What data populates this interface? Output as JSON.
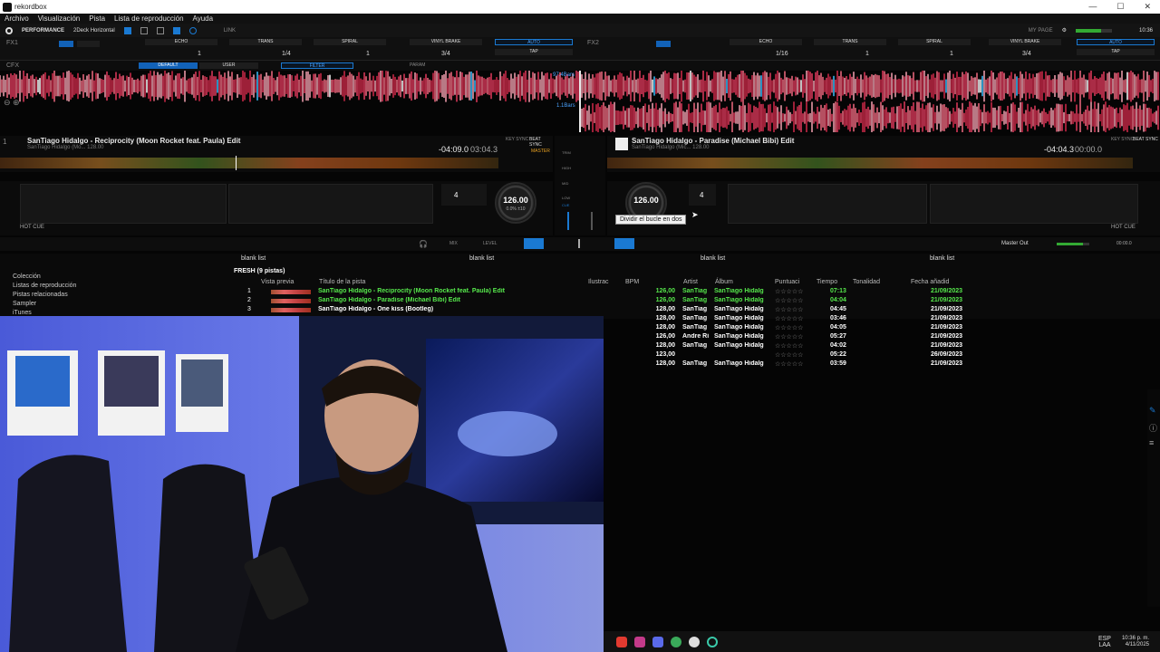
{
  "window": {
    "title": "rekordbox",
    "min": "—",
    "max": "☐",
    "close": "✕"
  },
  "menu": [
    "Archivo",
    "Visualización",
    "Pista",
    "Lista de reproducción",
    "Ayuda"
  ],
  "toolbar": {
    "mode": "PERFORMANCE",
    "layout": "2Deck Horizontal",
    "link": "LINK",
    "mypage": "MY PAGE",
    "clock": "10:36"
  },
  "fx1": {
    "label": "FX1",
    "effects": [
      "ECHO",
      "TRANS",
      "SPIRAL",
      "VINYL BRAKE"
    ],
    "values": [
      "1",
      "1/4",
      "1",
      "3/4"
    ],
    "auto": "AUTO",
    "tap": "TAP"
  },
  "fx2": {
    "label": "FX2",
    "effects": [
      "ECHO",
      "TRANS",
      "SPIRAL",
      "VINYL BRAKE"
    ],
    "values": [
      "1/16",
      "1",
      "1",
      "3/4"
    ],
    "auto": "AUTO",
    "tap": "TAP"
  },
  "cfx": {
    "label": "CFX",
    "default": "DEFAULT",
    "user": "USER",
    "filter": "FILTER",
    "param": "PARAM"
  },
  "overview": {
    "bar_marker_1": "97.4Bars",
    "bar_marker_2": "1.1Bars"
  },
  "deck1": {
    "title": "SanTiago Hidalgo - Reciprocity (Moon Rocket feat. Paula) Edit",
    "sub": "SanTiago Hidalgo (Mo...  128.00",
    "remain": "-04:09.0",
    "elapsed": "03:04.3",
    "bpm": "126.00",
    "pitch": "0.0%  ±10",
    "beat": "4",
    "master": "MASTER",
    "key_sync": "KEY SYNC",
    "beat_sync": "BEAT SYNC",
    "hotcue": "HOT CUE"
  },
  "deck2": {
    "title": "SanTiago Hidalgo - Paradise (Michael Bibi) Edit",
    "sub": "SanTiago Hidalgo (Mic...  128.00",
    "remain": "-04:04.3",
    "elapsed": "00:00.0",
    "bpm": "126.00",
    "beat": "4",
    "key_sync": "KEY SYNC",
    "beat_sync": "BEAT SYNC",
    "hotcue": "HOT CUE"
  },
  "tooltip": "Dividir el bucle en dos",
  "mixer": {
    "trim": "TRIM",
    "hi": "HIGH",
    "mid": "MID",
    "low": "LOW",
    "cue": "CUE",
    "master_out": "Master Out",
    "mix": "MIX",
    "level": "LEVEL",
    "master_time": "00:00.0"
  },
  "browser": {
    "tree": [
      "Colección",
      "Listas de reproducción",
      "Pistas relacionadas",
      "Sampler",
      "iTunes"
    ],
    "tabs": [
      "blank list",
      "blank list",
      "blank list",
      "blank list"
    ],
    "playlist_name": "FRESH (9 pistas)",
    "columns": [
      "Vista previa",
      "Título de la pista",
      "Ilustrac",
      "BPM",
      "Artist",
      "Álbum",
      "Puntuaci",
      "Tiempo",
      "Tonalidad",
      "Fecha añadid"
    ],
    "rows": [
      {
        "num": "1",
        "title": "SanTiago Hidalgo - Reciprocity (Moon Rocket feat. Paula) Edit",
        "bpm": "126,00",
        "artist": "SanTiag",
        "album": "SanTiago Hidalg",
        "rating": "☆☆☆☆☆",
        "time": "07:13",
        "date": "21/09/2023",
        "green": true
      },
      {
        "num": "2",
        "title": "SanTiago Hidalgo - Paradise (Michael Bibi) Edit",
        "bpm": "126,00",
        "artist": "SanTiag",
        "album": "SanTiago Hidalg",
        "rating": "☆☆☆☆☆",
        "time": "04:04",
        "date": "21/09/2023",
        "green": true
      },
      {
        "num": "3",
        "title": "SanTiago Hidalgo - One kiss (Bootleg)",
        "bpm": "128,00",
        "artist": "SanTiag",
        "album": "SanTiago Hidalg",
        "rating": "☆☆☆☆☆",
        "time": "04:45",
        "date": "21/09/2023",
        "green": false
      },
      {
        "num": "",
        "title": "",
        "bpm": "128,00",
        "artist": "SanTiag",
        "album": "SanTiago Hidalg",
        "rating": "☆☆☆☆☆",
        "time": "03:46",
        "date": "21/09/2023",
        "green": false
      },
      {
        "num": "",
        "title": "",
        "bpm": "128,00",
        "artist": "SanTiag",
        "album": "SanTiago Hidalg",
        "rating": "☆☆☆☆☆",
        "time": "04:05",
        "date": "21/09/2023",
        "green": false
      },
      {
        "num": "",
        "title": "",
        "bpm": "126,00",
        "artist": "Andre Ri",
        "album": "SanTiago Hidalg",
        "rating": "☆☆☆☆☆",
        "time": "05:27",
        "date": "21/09/2023",
        "green": false
      },
      {
        "num": "",
        "title": "",
        "bpm": "128,00",
        "artist": "SanTiag",
        "album": "SanTiago Hidalg",
        "rating": "☆☆☆☆☆",
        "time": "04:02",
        "date": "21/09/2023",
        "green": false
      },
      {
        "num": "",
        "title": "",
        "bpm": "123,00",
        "artist": "",
        "album": "",
        "rating": "☆☆☆☆☆",
        "time": "05:22",
        "date": "26/09/2023",
        "green": false
      },
      {
        "num": "",
        "title": "",
        "bpm": "128,00",
        "artist": "SanTiag",
        "album": "SanTiago Hidalg",
        "rating": "☆☆☆☆☆",
        "time": "03:59",
        "date": "21/09/2023",
        "green": false
      }
    ]
  },
  "taskbar": {
    "lang": "ESP",
    "lang2": "LAA",
    "time": "10:36 p. m.",
    "date": "4/11/2025"
  },
  "colors": {
    "accent": "#1a79d2",
    "green": "#56e84c",
    "waveform_red": "#e23a5c",
    "webcam_bg": "#3b4ab8"
  }
}
